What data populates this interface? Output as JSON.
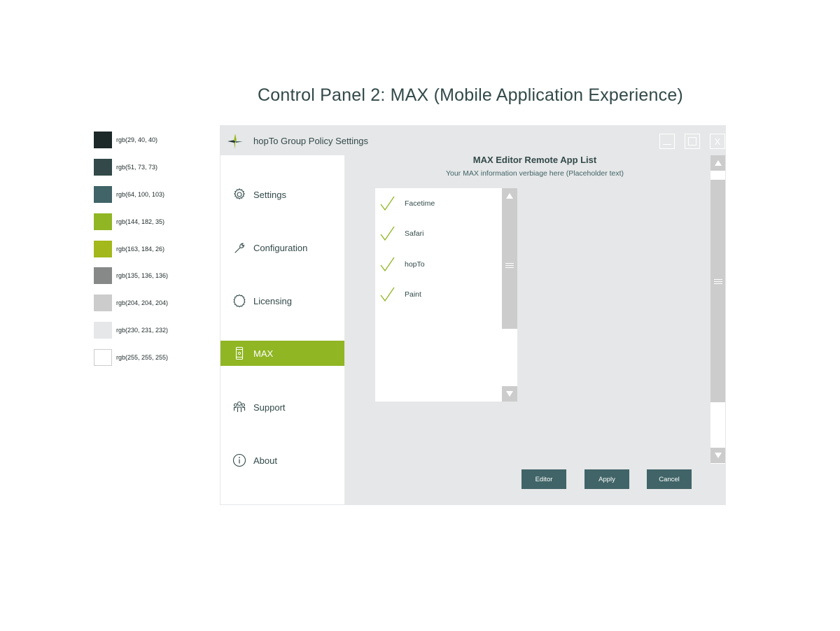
{
  "page": {
    "title": "Control Panel 2: MAX (Mobile Application Experience)"
  },
  "palette": [
    {
      "label": "rgb(29, 40, 40)",
      "color": "#1d2828"
    },
    {
      "label": "rgb(51, 73, 73)",
      "color": "#334949"
    },
    {
      "label": "rgb(64, 100, 103)",
      "color": "#406467"
    },
    {
      "label": "rgb(144, 182, 35)",
      "color": "#90b623"
    },
    {
      "label": "rgb(163, 184, 26)",
      "color": "#a3b81a"
    },
    {
      "label": "rgb(135, 136, 136)",
      "color": "#878888"
    },
    {
      "label": "rgb(204, 204, 204)",
      "color": "#cccccc"
    },
    {
      "label": "rgb(230, 231, 232)",
      "color": "#e6e7e8"
    },
    {
      "label": "rgb(255, 255, 255)",
      "color": "#ffffff"
    }
  ],
  "window": {
    "title": "hopTo Group Policy Settings",
    "close_label": "X",
    "minimize_icon": "minimize-icon",
    "maximize_icon": "maximize-icon"
  },
  "sidebar": {
    "items": [
      {
        "label": "Settings",
        "icon": "gear-icon",
        "active": false
      },
      {
        "label": "Configuration",
        "icon": "wrench-icon",
        "active": false
      },
      {
        "label": "Licensing",
        "icon": "badge-icon",
        "active": false
      },
      {
        "label": "MAX",
        "icon": "mobile-icon",
        "active": true
      },
      {
        "label": "Support",
        "icon": "people-icon",
        "active": false
      },
      {
        "label": "About",
        "icon": "info-icon",
        "active": false
      }
    ]
  },
  "main": {
    "heading": "MAX Editor Remote App List",
    "subtitle": "Your MAX information verbiage here (Placeholder text)",
    "apps": [
      {
        "label": "Facetime",
        "checked": true
      },
      {
        "label": "Safari",
        "checked": true
      },
      {
        "label": "hopTo",
        "checked": true
      },
      {
        "label": "Paint",
        "checked": true
      }
    ],
    "buttons": {
      "editor": "Editor",
      "apply": "Apply",
      "cancel": "Cancel"
    }
  },
  "colors": {
    "accent": "#90b623",
    "button": "#406467",
    "panel": "#e6e7e8",
    "scrollbar": "#cccccc"
  }
}
